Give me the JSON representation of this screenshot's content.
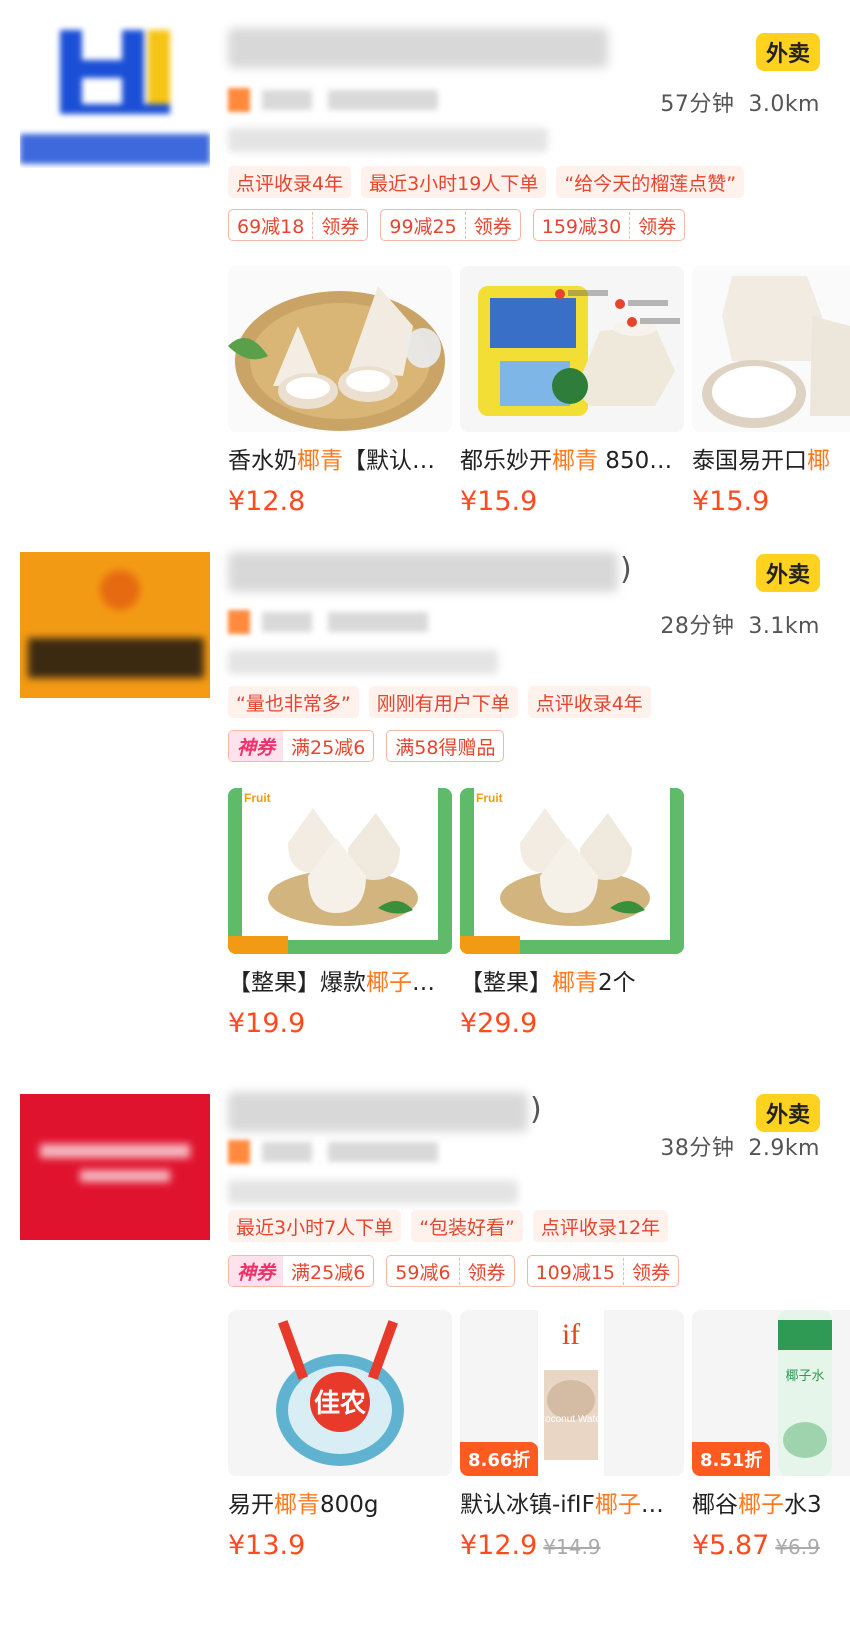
{
  "shops": [
    {
      "badge": "外卖",
      "eta_time": "57分钟",
      "distance": "3.0km",
      "tags": [
        "点评收录4年",
        "最近3小时19人下单",
        "“给今天的榴莲点赞”"
      ],
      "coupons": [
        {
          "text": "69减18",
          "action": "领券"
        },
        {
          "text": "99减25",
          "action": "领券"
        },
        {
          "text": "159减30",
          "action": "领券"
        }
      ],
      "products": [
        {
          "title_pre": "香水奶",
          "title_hl": "椰青",
          "title_post": "【默认…",
          "price": "¥12.8"
        },
        {
          "title_pre": "都乐妙开",
          "title_hl": "椰青",
          "title_post": " 850…",
          "price": "¥15.9"
        },
        {
          "title_pre": "泰国易开口",
          "title_hl": "椰",
          "title_post": "",
          "price": "¥15.9"
        }
      ]
    },
    {
      "badge": "外卖",
      "name_tail": ")",
      "eta_time": "28分钟",
      "distance": "3.1km",
      "tags": [
        "“量也非常多”",
        "刚刚有用户下单",
        "点评收录4年"
      ],
      "shenquan": {
        "badge": "神券",
        "text": "满25减6"
      },
      "coupons": [
        {
          "text": "满58得赠品"
        }
      ],
      "products": [
        {
          "title_pre": "【整果】爆款",
          "title_hl": "椰子",
          "title_post": "…",
          "price": "¥19.9"
        },
        {
          "title_pre": "【整果】",
          "title_hl": "椰青",
          "title_post": "2个",
          "price": "¥29.9"
        }
      ]
    },
    {
      "badge": "外卖",
      "name_tail": ")",
      "eta_time": "38分钟",
      "distance": "2.9km",
      "tags": [
        "最近3小时7人下单",
        "“包装好看”",
        "点评收录12年"
      ],
      "shenquan": {
        "badge": "神券",
        "text": "满25减6"
      },
      "coupons": [
        {
          "text": "59减6",
          "action": "领券"
        },
        {
          "text": "109减15",
          "action": "领券"
        }
      ],
      "products": [
        {
          "title_pre": "易开",
          "title_hl": "椰青",
          "title_post": "800g",
          "price": "¥13.9"
        },
        {
          "title_pre": "默认冰镇-ifIF",
          "title_hl": "椰子",
          "title_post": "…",
          "price": "¥12.9",
          "old_price": "¥14.9",
          "discount": "8.66折"
        },
        {
          "title_pre": "椰谷",
          "title_hl": "椰子",
          "title_post": "水3",
          "price": "¥5.87",
          "old_price": "¥6.9",
          "discount": "8.51折"
        }
      ]
    }
  ],
  "image_text": {
    "fruit_brand": "Fruit",
    "jianong": "佳农",
    "if_brand": "if",
    "coconut_water": "Coconut Water",
    "yegu_label": "椰子水"
  }
}
